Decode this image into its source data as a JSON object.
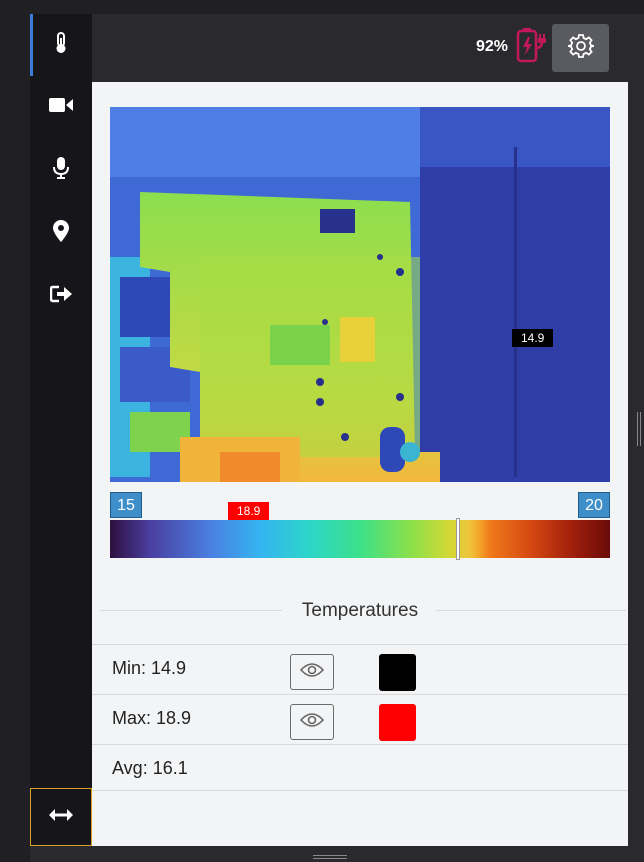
{
  "colors": {
    "sidebar_bg": "#16161a",
    "accent_active": "#3d7bd9",
    "battery_icon": "#c2185b",
    "min_marker": "#000000",
    "max_marker": "#ff0000"
  },
  "sidebar": {
    "items": [
      {
        "icon": "thermometer-icon",
        "active": true
      },
      {
        "icon": "video-camera-icon",
        "active": false
      },
      {
        "icon": "microphone-icon",
        "active": false
      },
      {
        "icon": "map-pin-icon",
        "active": false
      },
      {
        "icon": "logout-icon",
        "active": false
      }
    ],
    "expand_icon": "double-arrow-horizontal-icon"
  },
  "topbar": {
    "battery_percent": "92%",
    "battery_icon": "battery-charging-icon",
    "settings_icon": "gear-icon"
  },
  "thermal": {
    "min_marker": "14.9",
    "max_marker": "18.9",
    "scale_min": "15",
    "scale_max": "20"
  },
  "temperatures": {
    "title": "Temperatures",
    "rows": [
      {
        "label": "Min: 14.9",
        "has_eye": true,
        "swatch": "#000000"
      },
      {
        "label": "Max: 18.9",
        "has_eye": true,
        "swatch": "#ff0000"
      },
      {
        "label": "Avg: 16.1",
        "has_eye": false
      }
    ]
  }
}
